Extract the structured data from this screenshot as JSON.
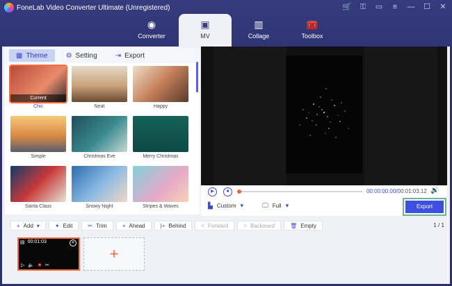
{
  "app": {
    "title": "FoneLab Video Converter Ultimate (Unregistered)",
    "window_controls": [
      "cart-icon",
      "key-icon",
      "chat-icon",
      "menu-icon",
      "minimize-icon",
      "maximize-icon",
      "close-icon"
    ]
  },
  "nav": {
    "tabs": [
      {
        "label": "Converter",
        "icon": "converter-icon",
        "active": false
      },
      {
        "label": "MV",
        "icon": "mv-icon",
        "active": true
      },
      {
        "label": "Collage",
        "icon": "collage-icon",
        "active": false
      },
      {
        "label": "Toolbox",
        "icon": "toolbox-icon",
        "active": false
      }
    ]
  },
  "left_tabs": {
    "theme": "Theme",
    "setting": "Setting",
    "export": "Export"
  },
  "themes": [
    {
      "name": "Chic",
      "selected": true,
      "current_label": "Current"
    },
    {
      "name": "Neat"
    },
    {
      "name": "Happy"
    },
    {
      "name": "Simple"
    },
    {
      "name": "Christmas Eve"
    },
    {
      "name": "Merry Christmas"
    },
    {
      "name": "Santa Claus"
    },
    {
      "name": "Snowy Night"
    },
    {
      "name": "Stripes & Waves"
    }
  ],
  "player": {
    "current_time": "00:00:00.00",
    "total_time": "00:01:03.12",
    "aspect": "Custom",
    "view": "Full",
    "export_label": "Export"
  },
  "toolbar": {
    "add": "Add",
    "edit": "Edit",
    "trim": "Trim",
    "ahead": "Ahead",
    "behind": "Behind",
    "forward": "Forward",
    "backward": "Backward",
    "empty": "Empty",
    "pager": "1 / 1"
  },
  "clip": {
    "duration": "00:01:03"
  },
  "colors": {
    "accent": "#3d4fe0",
    "header": "#2f3474",
    "highlight": "#ff6a3d"
  }
}
